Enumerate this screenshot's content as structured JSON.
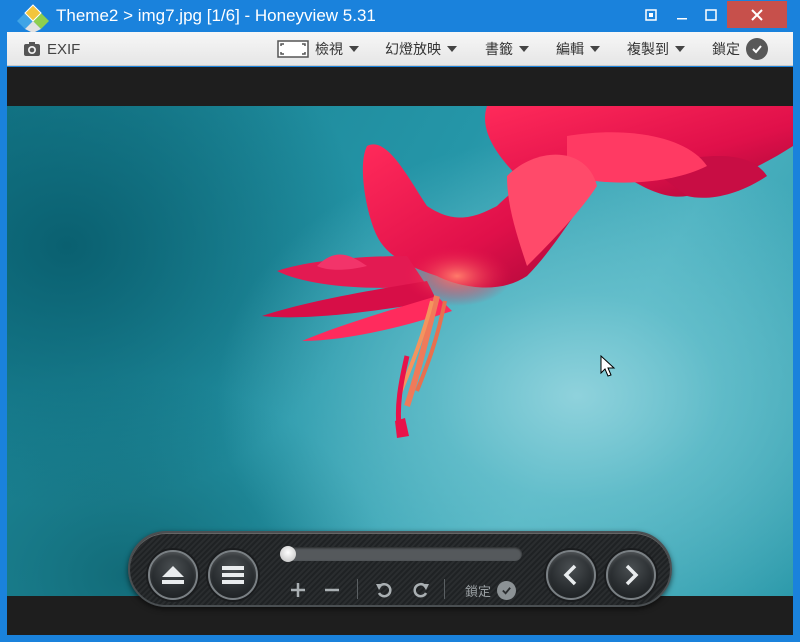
{
  "window": {
    "title": "Theme2 > img7.jpg [1/6] - Honeyview 5.31"
  },
  "toolbar": {
    "exif_label": "EXIF",
    "view_label": "檢視",
    "slideshow_label": "幻燈放映",
    "bookmark_label": "書籤",
    "edit_label": "編輯",
    "copyto_label": "複製到",
    "lock_label": "鎖定"
  },
  "controls": {
    "lock_label": "鎖定",
    "progress": 0.0
  },
  "colors": {
    "titlebar": "#1a82dc",
    "close_button": "#c7504b",
    "flower_accent": "#e8124a"
  },
  "icons": {
    "app": "honeyview-logo-icon",
    "camera": "camera-icon",
    "view": "frame-icon",
    "eject": "eject-icon",
    "menu": "menu-icon",
    "prev": "chevron-left-icon",
    "next": "chevron-right-icon"
  }
}
